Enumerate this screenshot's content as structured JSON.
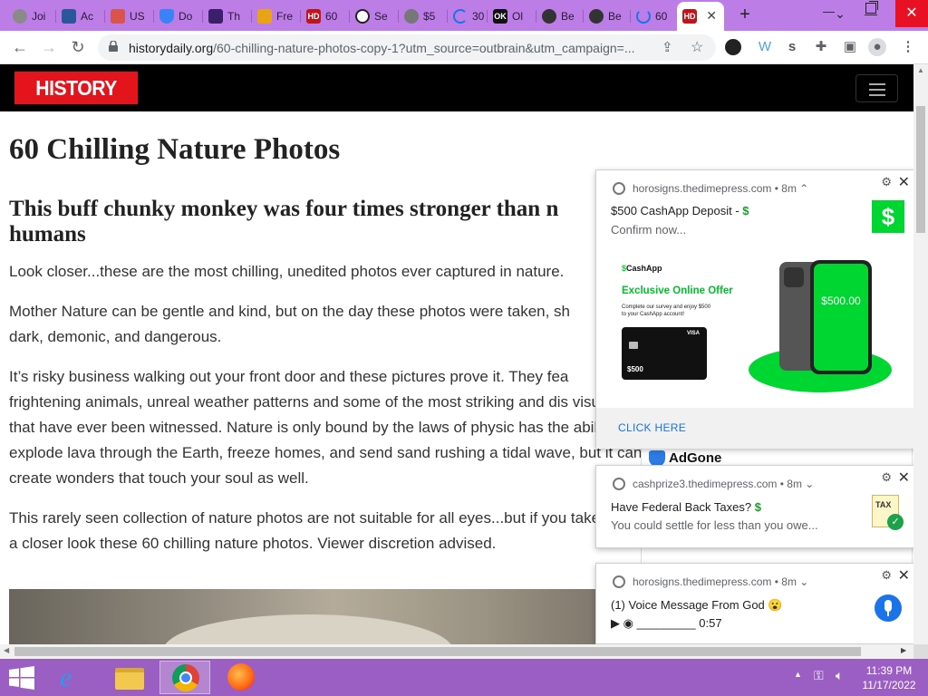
{
  "browser": {
    "tabs": [
      {
        "label": "Joi",
        "color": "#8a8a8a"
      },
      {
        "label": "Ac",
        "color": "#2b579a"
      },
      {
        "label": "US",
        "color": "#d9534f"
      },
      {
        "label": "Do",
        "color": "#3b82f6"
      },
      {
        "label": "Th",
        "color": "#3b1f6b"
      },
      {
        "label": "Fre",
        "color": "#e8a317"
      },
      {
        "label": "60",
        "color": "#c0141c"
      },
      {
        "label": "Se",
        "color": "#222222"
      },
      {
        "label": "$5",
        "color": "#777777"
      },
      {
        "label": "30",
        "color": "#1a73e8"
      },
      {
        "label": "Ol",
        "color": "#111111"
      },
      {
        "label": "Be",
        "color": "#333333"
      },
      {
        "label": "Be",
        "color": "#333333"
      },
      {
        "label": "60",
        "color": "#1a73e8"
      }
    ],
    "active_tab_favicon": "HD",
    "url_domain": "historydaily.org",
    "url_path": "/60-chilling-nature-photos-copy-1?utm_source=outbrain&utm_campaign=..."
  },
  "site": {
    "logo": "HISTORY DAILY"
  },
  "article": {
    "title": "60 Chilling Nature Photos",
    "subtitle": "This buff chunky monkey was four times stronger than n humans",
    "paragraphs": [
      "Look closer...these are the most chilling, unedited photos ever captured in nature.",
      "Mother Nature can be gentle and kind, but on the day these photos were taken, sh dark, demonic, and dangerous.",
      "It’s risky business walking out your front door and these pictures prove it. They fea frightening animals, unreal weather patterns and some of the most striking and dis visuals that have ever been witnessed. Nature is only bound by the laws of physic has the ability to explode lava through the Earth, freeze homes, and send sand rushing a tidal wave, but it can create wonders that touch your soul as well.",
      "This rarely seen collection of nature photos are not suitable for all eyes...but if you take a closer look these 60 chilling nature photos. Viewer discretion advised."
    ],
    "sidebar_ad": "AdGone"
  },
  "notifications": [
    {
      "source": "horosigns.thedimepress.com • 8m",
      "title": "$500 CashApp Deposit - ",
      "title_suffix": "$",
      "message": "Confirm now...",
      "cta": "CLICK HERE",
      "hero": {
        "brand": "CashApp",
        "offer": "Exclusive Online Offer",
        "desc_line1": "Complete our survey and enjoy $500",
        "desc_line2": "to your CashApp account!",
        "card_amount": "$500",
        "card_brand": "VISA",
        "phone_amount": "$500.00"
      }
    },
    {
      "source": "cashprize3.thedimepress.com • 8m",
      "title": "Have Federal Back Taxes? ",
      "title_suffix": "$",
      "message": "You could settle for less than you owe...",
      "icon_label": "TAX"
    },
    {
      "source": "horosigns.thedimepress.com • 8m",
      "title": "(1) Voice Message From God 😮",
      "message": "▶ ◉ _________ 0:57"
    }
  ],
  "taskbar": {
    "time": "11:39 PM",
    "date": "11/17/2022"
  }
}
